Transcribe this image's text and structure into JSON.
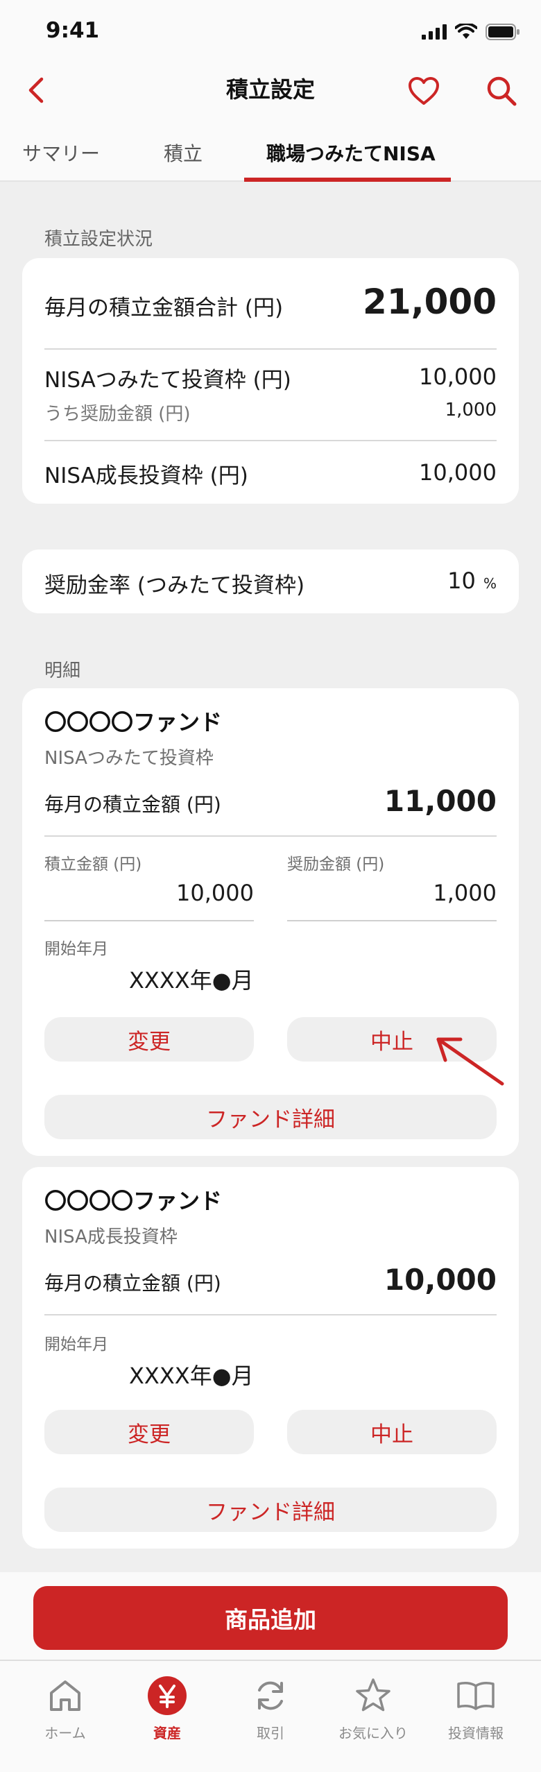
{
  "status_bar": {
    "time": "9:41"
  },
  "nav": {
    "title": "積立設定",
    "back_icon": "chevron-left-icon",
    "favorite_icon": "heart-icon",
    "search_icon": "search-icon"
  },
  "tabs": [
    {
      "label": "サマリー",
      "active": false
    },
    {
      "label": "積立",
      "active": false
    },
    {
      "label": "職場つみたてNISA",
      "active": true
    }
  ],
  "status_section": {
    "label": "積立設定状況",
    "monthly_total_label": "毎月の積立金額合計 (円)",
    "monthly_total_value": "21,000",
    "tsumitate_label": "NISAつみたて投資枠 (円)",
    "tsumitate_value": "10,000",
    "incentive_label": "うち奨励金額 (円)",
    "incentive_value": "1,000",
    "growth_label": "NISA成長投資枠 (円)",
    "growth_value": "10,000"
  },
  "incentive_rate": {
    "label": "奨励金率 (つみたて投資枠)",
    "value": "10",
    "unit": "%"
  },
  "details": {
    "label": "明細",
    "funds": [
      {
        "name": "〇〇〇〇ファンド",
        "type": "NISAつみたて投資枠",
        "monthly_label": "毎月の積立金額 (円)",
        "monthly_value": "11,000",
        "contribution_label": "積立金額 (円)",
        "contribution_value": "10,000",
        "incentive_label": "奨励金額 (円)",
        "incentive_value": "1,000",
        "start_label": "開始年月",
        "start_value": "XXXX年●月",
        "change_label": "変更",
        "stop_label": "中止",
        "detail_label": "ファンド詳細"
      },
      {
        "name": "〇〇〇〇ファンド",
        "type": "NISA成長投資枠",
        "monthly_label": "毎月の積立金額 (円)",
        "monthly_value": "10,000",
        "start_label": "開始年月",
        "start_value": "XXXX年●月",
        "change_label": "変更",
        "stop_label": "中止",
        "detail_label": "ファンド詳細"
      }
    ]
  },
  "cta": {
    "label": "商品追加"
  },
  "tabbar": [
    {
      "label": "ホーム",
      "icon": "home-icon",
      "active": false
    },
    {
      "label": "資産",
      "icon": "yen-icon",
      "active": true
    },
    {
      "label": "取引",
      "icon": "refresh-icon",
      "active": false
    },
    {
      "label": "お気に入り",
      "icon": "star-icon",
      "active": false
    },
    {
      "label": "投資情報",
      "icon": "book-icon",
      "active": false
    }
  ],
  "colors": {
    "accent": "#cc2525",
    "background": "#efefef",
    "card": "#ffffff"
  }
}
